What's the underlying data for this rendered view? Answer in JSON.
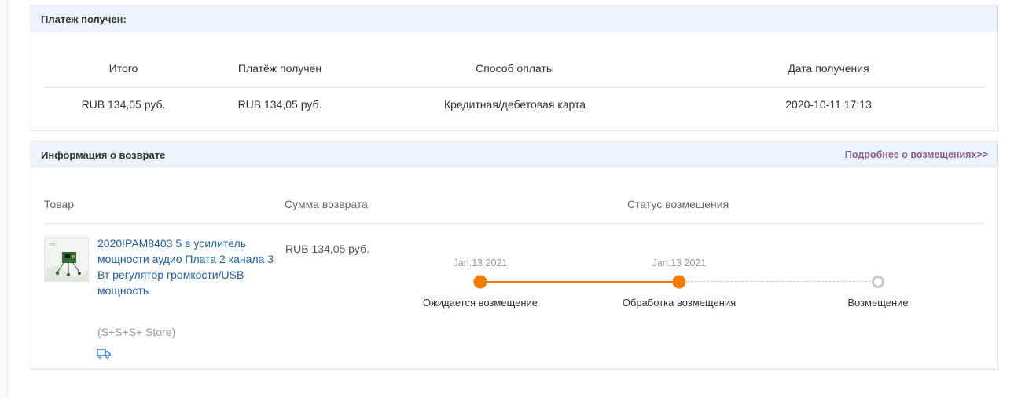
{
  "payment": {
    "header": "Платеж получен:",
    "columns": [
      "Итого",
      "Платёж получен",
      "Способ оплаты",
      "Дата получения"
    ],
    "values": [
      "RUB 134,05 руб.",
      "RUB 134,05 руб.",
      "Кредитная/дебетовая карта",
      "2020-10-11 17:13"
    ]
  },
  "refund": {
    "header": "Информация о возврате",
    "more_link": "Подробнее о возмещениях>>",
    "columns": [
      "Товар",
      "Сумма возврата",
      "Статус возмещения"
    ],
    "item": {
      "title": "2020!PAM8403 5 в усилитель мощности аудио Плата 2 канала 3 Вт регулятор громкости/USB мощность",
      "store": "(S+S+S+ Store)",
      "amount": "RUB 134,05 руб."
    },
    "timeline": {
      "steps": [
        {
          "date": "Jan.13 2021",
          "label": "Ожидается возмещение",
          "done": true
        },
        {
          "date": "Jan.13 2021",
          "label": "Обработка возмещения",
          "done": true
        },
        {
          "date": "",
          "label": "Возмещение",
          "done": false
        }
      ],
      "active_color": "#f57c00",
      "inactive_color": "#c8c8c8"
    }
  }
}
